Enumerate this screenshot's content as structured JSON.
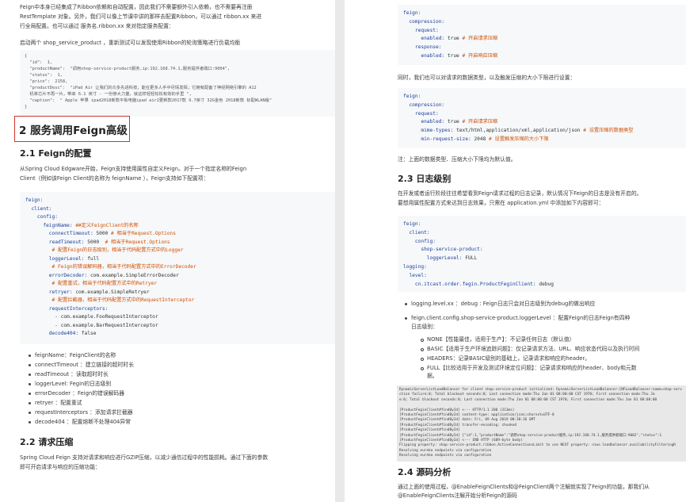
{
  "left": {
    "intro_lines": [
      "Feign中本身已经集成了Ribbon依赖和自动配置，因此我们不需要额外引入依赖，也不需要再注册",
      "RestTemplate 对象。另外，我们可以像上节课中讲的那样去配置Ribbon，可以通过 ribbon.xx 来进",
      "行全局配置。也可以通过 服务名.ribbon.xx 来对指定服务配置：",
      "启动两个 shop_service_product ，重新测试可以发现使用Ribbon的轮询策略进行负载均衡"
    ],
    "json_lines": [
      "{",
      "  \"id\":  1,",
      "  \"productName\":  \"调用shop-service-product服务,ip:192.168.74.1,服务提供者端口:9004\",",
      "  \"status\":  1,",
      "  \"price\":  2158,",
      "  \"productDesc\":  \"iPad Air 让我们的众多先进科技，能在更多人手中尽情发挥；它拥有配备了神经网络引擎的 A12",
      "  机单芯片不再一片，带来 6.1 英寸 - 一份惨大力量，就这样轻轻松松有效的手里 \",",
      "  \"caption\":  \" Apple 苹果 ipad2018新款平板电脑ipad air2更新款2017款 9.7英寸 32G金色 2018新款 标配WLAN版\"",
      "}"
    ],
    "h2_feign_advanced": "2 服务调用Feign高级",
    "h3_feign_config": "2.1 Feign的配置",
    "feign_config_lines": [
      "从Spring Cloud Edgware开始，Feign支持使用属性自定义Feign。对于一个指定名称的Feign",
      "Client（例如该Feign Client的名称为 feignName ），Feign支持如下配置项："
    ],
    "code1": [
      {
        "k": "feign:",
        "v": "",
        "c": ""
      },
      {
        "k": "  client:",
        "v": "",
        "c": ""
      },
      {
        "k": "    config:",
        "v": "",
        "c": ""
      },
      {
        "k": "      feignName:",
        "v": "",
        "c": "##定义FeignClient的名称"
      },
      {
        "k": "        connectTimeout:",
        "v": " 5000",
        "c": "# 相当于Request.Options"
      },
      {
        "k": "        readTimeout:",
        "v": " 5000 ",
        "c": "# 相当于Request.Options"
      },
      {
        "k": "        ",
        "v": "",
        "c": "# 配置Feign的日志级别，相当于代码配置方式中的Logger"
      },
      {
        "k": "        loggerLevel:",
        "v": " full",
        "c": ""
      },
      {
        "k": "        ",
        "v": "",
        "c": "# Feign的错误解码器，相当于代码配置方式中的ErrorDecoder"
      },
      {
        "k": "        errorDecoder:",
        "v": " com.example.SimpleErrorDecoder",
        "c": ""
      },
      {
        "k": "        ",
        "v": "",
        "c": "# 配置重试，相当于代码配置方式中的Retryer"
      },
      {
        "k": "        retryer:",
        "v": " com.example.SimpleRetryer",
        "c": ""
      },
      {
        "k": "        ",
        "v": "",
        "c": "# 配置拦截器，相当于代码配置方式中的RequestInterceptor"
      },
      {
        "k": "        requestInterceptors:",
        "v": "",
        "c": ""
      },
      {
        "k": "          - ",
        "v": "com.example.FooRequestInterceptor",
        "c": ""
      },
      {
        "k": "          - ",
        "v": "com.example.BarRequestInterceptor",
        "c": ""
      },
      {
        "k": "        decode404:",
        "v": " false",
        "c": ""
      }
    ],
    "bullets": [
      "feignName：FeignClient的名称",
      "connectTimeout ：建立链接的超时时长",
      "readTimeout ：读取超时时长",
      "loggerLevel: Fegin的日志级别",
      "errorDecoder ：Feign的错误解码器",
      "retryer ：配置重试",
      "requestInterceptors ：添加请求拦截器",
      "decode404 ：配置熔断不处理404异常"
    ],
    "h3_compress": "2.2 请求压缩",
    "compress_lines": [
      "Spring Cloud Feign 支持对请求和响应进行GZIP压缩，以减少通信过程中的性能损耗。通过下面的参数",
      "即可开启请求与响应的压缩功能："
    ]
  },
  "right": {
    "code2": [
      {
        "k": "feign:",
        "v": "",
        "c": ""
      },
      {
        "k": "  compression:",
        "v": "",
        "c": ""
      },
      {
        "k": "    request:",
        "v": "",
        "c": ""
      },
      {
        "k": "      enabled:",
        "v": " true",
        "c": "# 开启请求压缩"
      },
      {
        "k": "    response:",
        "v": "",
        "c": ""
      },
      {
        "k": "      enabled:",
        "v": " true",
        "c": "# 开启响应压缩"
      }
    ],
    "mid_text": "同时，我们也可以对请求的数据类型，以及触发压缩的大小下限进行设置：",
    "code3": [
      {
        "k": "feign:",
        "v": "",
        "c": ""
      },
      {
        "k": "  compression:",
        "v": "",
        "c": ""
      },
      {
        "k": "    request:",
        "v": "",
        "c": ""
      },
      {
        "k": "      enabled:",
        "v": " true",
        "c": "# 开启请求压缩"
      },
      {
        "k": "      mime-types:",
        "v": " text/html,application/xml,application/json",
        "c": "# 设置压缩的数据类型"
      },
      {
        "k": "      min-request-size:",
        "v": " 2048",
        "c": "# 设置触发压缩的大小下限"
      }
    ],
    "note": "注：上面的数据类型、压缩大小下限均为默认值。",
    "h3_log": "2.3 日志级别",
    "log_lines": [
      "在开发或者运行阶段往往希望看到Feign请求过程的日志记录，默认情况下Feign的日志是没有开启的。",
      "要想用属性配置方式来达到日志效果，只需在 application.yml 中添加如下内容即可："
    ],
    "code4": [
      {
        "k": "feign:",
        "v": "",
        "c": ""
      },
      {
        "k": "  client:",
        "v": "",
        "c": ""
      },
      {
        "k": "    config:",
        "v": "",
        "c": ""
      },
      {
        "k": "      shop-service-product:",
        "v": "",
        "c": ""
      },
      {
        "k": "        loggerLevel:",
        "v": " FULL",
        "c": ""
      },
      {
        "k": "logging:",
        "v": "",
        "c": ""
      },
      {
        "k": "  level:",
        "v": "",
        "c": ""
      },
      {
        "k": "    cn.itcast.order.fegin.ProductFeginClient:",
        "v": " debug",
        "c": ""
      }
    ],
    "b1": "logging.level.xx ：debug : Feign日志只会对日志级别为debug的做出响应",
    "b2a": "feign.client.config.shop-service-product.loggerLevel ：配置Feign的日志Feign有四种",
    "b2b": "日志级别：",
    "levels": [
      "NONE【性能最佳，适用于生产】：不记录任何日志（默认值）",
      "BASIC【适用于生产环境追踪问题】：仅记录请求方法、URL、响应状态代码以及执行时间",
      "HEADERS：记录BASIC级别的基础上，记录请求和响应的header。",
      "FULL【比较适用于开发及测试环境定位问题】：记录请求和响应的header、body和元数",
      "据。"
    ],
    "console": [
      "DynamicServerListLoadBalancer for client shop-service-product initialized: DynamicServerListLoadBalancer:{NFLoadBalancer:name=shop-serv",
      "ction failure:0;   Total blackout seconds:0;   Last connection made:Thu Jan 01 08:00:00 CST 1970;  First connection made:Thu Ja",
      "e:0;   Total blackout seconds:0;   Last connection made:Thu Jan 01 08:00:00 CST 1970;  First connection made:Thu Jan 01 08:00:00",
      "",
      "[ProductFeginClient#findById] <--- HTTP/1.1 200 (313ms)",
      "[ProductFeginClient#findById] content-type: application/json;charset=UTF-8",
      "[ProductFeginClient#findById] date: Fri, 09 Aug 2019 08:38:36 GMT",
      "[ProductFeginClient#findById] transfer-encoding: chunked",
      "[ProductFeginClient#findById]",
      "[ProductFeginClient#findById] {\"id\":1,\"productName\":\"调用shop-service-product服务,ip:192.168.74.1,服务提供者端口:9002\",\"status\":1",
      "[ProductFeginClient#findById] <--- END HTTP (609-byte body)",
      "Flipping property: shop-service-product.ribbon.ActiveConnectionsLimit to use NEXT property: niws.loadbalancer.availabilityFilteringR",
      "Resolving eureka endpoints via configuration",
      "Resolving eureka endpoints via configuration"
    ],
    "h3_source": "2.4 源码分析",
    "source_lines": [
      "通过上面的使用过程，@EnableFeignClients和@FeignClient两个注解就实现了Feign的功能，那我们从",
      "@EnableFeignClients注解开始分析Feign的源码"
    ]
  }
}
